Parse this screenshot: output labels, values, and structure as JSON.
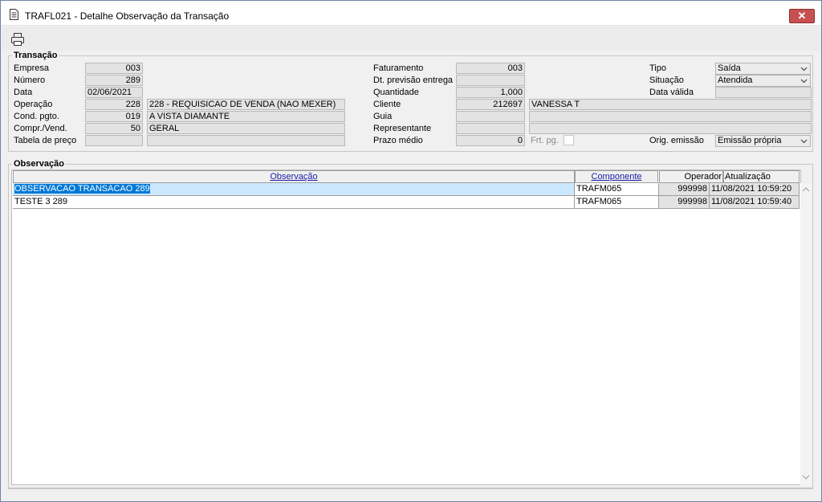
{
  "window": {
    "title": "TRAFL021 - Detalhe Observação da Transação",
    "close_label": "✕"
  },
  "icons": {
    "app": "document-icon",
    "print": "printer-icon",
    "close": "close-icon",
    "dropdown": "chevron-down-icon"
  },
  "transacao": {
    "legend": "Transação",
    "empresa": {
      "label": "Empresa",
      "value": "003"
    },
    "numero": {
      "label": "Número",
      "value": "289"
    },
    "data": {
      "label": "Data",
      "value": "02/06/2021"
    },
    "operacao": {
      "label": "Operação",
      "code": "228",
      "desc": "228 - REQUISICAO DE VENDA (NAO MEXER)"
    },
    "cond_pgto": {
      "label": "Cond. pgto.",
      "code": "019",
      "desc": "A VISTA DIAMANTE"
    },
    "compr_vend": {
      "label": "Compr./Vend.",
      "code": "50",
      "desc": "GERAL"
    },
    "tabela_preco": {
      "label": "Tabela de preço",
      "code": "",
      "desc": ""
    },
    "faturamento": {
      "label": "Faturamento",
      "value": "003"
    },
    "dt_previsao": {
      "label": "Dt. previsão entrega",
      "value": ""
    },
    "quantidade": {
      "label": "Quantidade",
      "value": "1,000"
    },
    "cliente": {
      "label": "Cliente",
      "code": "212697",
      "name": "VANESSA T"
    },
    "guia": {
      "label": "Guia",
      "code": "",
      "name": ""
    },
    "representante": {
      "label": "Representante",
      "code": "",
      "name": ""
    },
    "prazo_medio": {
      "label": "Prazo médio",
      "value": "0"
    },
    "frt_pg": {
      "label": "Frt. pg.",
      "checked": false
    },
    "tipo": {
      "label": "Tipo",
      "value": "Saída"
    },
    "situacao": {
      "label": "Situação",
      "value": "Atendida"
    },
    "data_valida": {
      "label": "Data válida",
      "value": ""
    },
    "orig_emissao": {
      "label": "Orig. emissão",
      "value": "Emissão própria"
    }
  },
  "observacao": {
    "legend": "Observação",
    "columns": {
      "observacao": "Observação",
      "componente": "Componente",
      "operador": "Operador",
      "atualizacao": "Atualização"
    },
    "rows": [
      {
        "observacao": "OBSERVACAO TRANSACAO 289",
        "componente": "TRAFM065",
        "operador": "999998",
        "atualizacao": "11/08/2021 10:59:20"
      },
      {
        "observacao": "TESTE 3 289",
        "componente": "TRAFM065",
        "operador": "999998",
        "atualizacao": "11/08/2021 10:59:40"
      }
    ]
  },
  "colors": {
    "selection": "#0078d7",
    "selection_row": "#cce8ff",
    "close_button": "#c75050",
    "header_link": "#1a1aa6"
  }
}
